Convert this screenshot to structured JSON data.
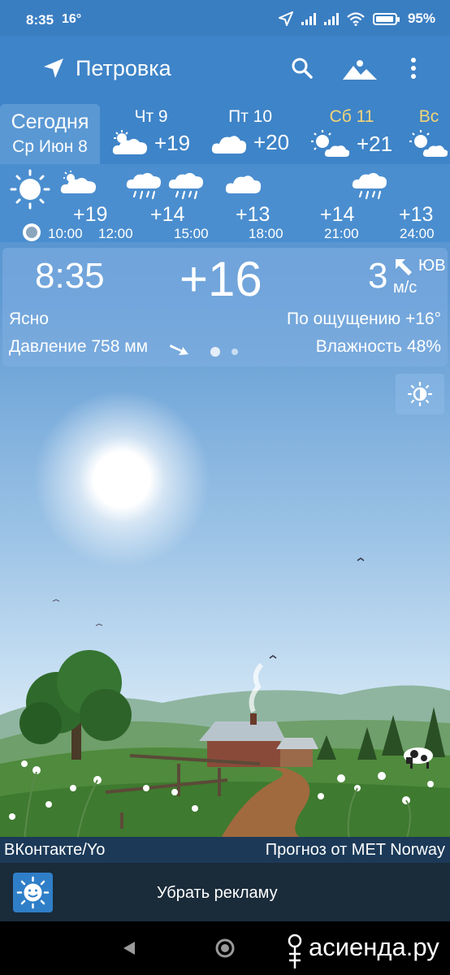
{
  "status": {
    "time": "8:35",
    "temp": "16°",
    "battery": "95%"
  },
  "app": {
    "location": "Петровка"
  },
  "daily": {
    "today_label": "Сегодня",
    "today_date": "Ср Июн 8",
    "days": [
      {
        "name": "Чт 9",
        "temp": "+19",
        "icon": "cloud-sun-icon",
        "weekend": false
      },
      {
        "name": "Пт 10",
        "temp": "+20",
        "icon": "cloud-icon",
        "weekend": false
      },
      {
        "name": "Сб 11",
        "temp": "+21",
        "icon": "sun-cloud-icon",
        "weekend": true
      },
      {
        "name": "Вс",
        "temp": "",
        "icon": "sun-cloud-icon",
        "weekend": true
      }
    ]
  },
  "hourly": [
    {
      "time": "10:00",
      "temp": "",
      "icon": "sun-icon"
    },
    {
      "time": "12:00",
      "temp": "+19",
      "icon": "cloud-sun-icon"
    },
    {
      "time": "15:00",
      "temp": "+14",
      "icon": "rain-icon"
    },
    {
      "time": "18:00",
      "temp": "+13",
      "icon": "cloud-icon"
    },
    {
      "time": "21:00",
      "temp": "+14",
      "icon": "rain-icon"
    },
    {
      "time": "24:00",
      "temp": "+13",
      "icon": ""
    }
  ],
  "current": {
    "time": "8:35",
    "temp": "+16",
    "wind_speed": "3",
    "wind_dir": "ЮВ",
    "wind_unit": "м/с",
    "condition": "Ясно",
    "feels_like": "По ощущению +16°",
    "pressure": "Давление 758 мм",
    "humidity": "Влажность 48%"
  },
  "footer": {
    "source_left": "ВКонтакте/Yo",
    "source_right": "Прогноз от MET Norway",
    "remove_ads": "Убрать рекламу"
  },
  "watermark": "асиенда.ру"
}
